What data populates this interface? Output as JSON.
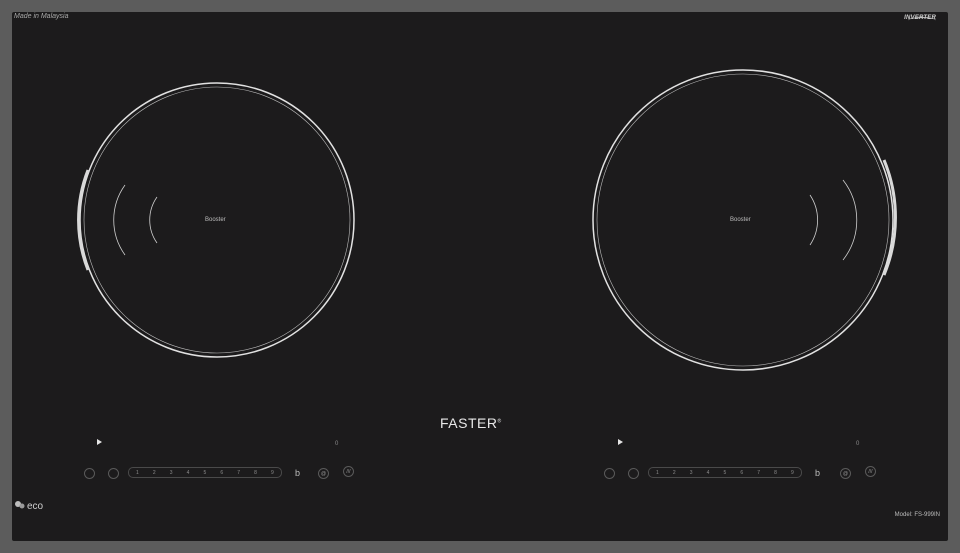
{
  "labels": {
    "made_in": "Made in Malaysia",
    "inverter": "INVERTER",
    "brand": "FASTER",
    "brand_mark": "®",
    "model": "Model: FS-999IN",
    "eco": "eco",
    "booster_left": "Booster",
    "booster_right": "Booster"
  },
  "left_controls": {
    "levels": [
      "1",
      "2",
      "3",
      "4",
      "5",
      "6",
      "7",
      "8",
      "9"
    ],
    "lock_glyph": "b",
    "timer_glyph": "@",
    "zone_glyph": "///",
    "small_indicator": "0"
  },
  "right_controls": {
    "levels": [
      "1",
      "2",
      "3",
      "4",
      "5",
      "6",
      "7",
      "8",
      "9"
    ],
    "lock_glyph": "b",
    "timer_glyph": "@",
    "zone_glyph": "///",
    "small_indicator": "0"
  },
  "colors": {
    "frame": "#5c5c5c",
    "glass": "#1c1b1c",
    "ring": "#e0e0e0"
  }
}
